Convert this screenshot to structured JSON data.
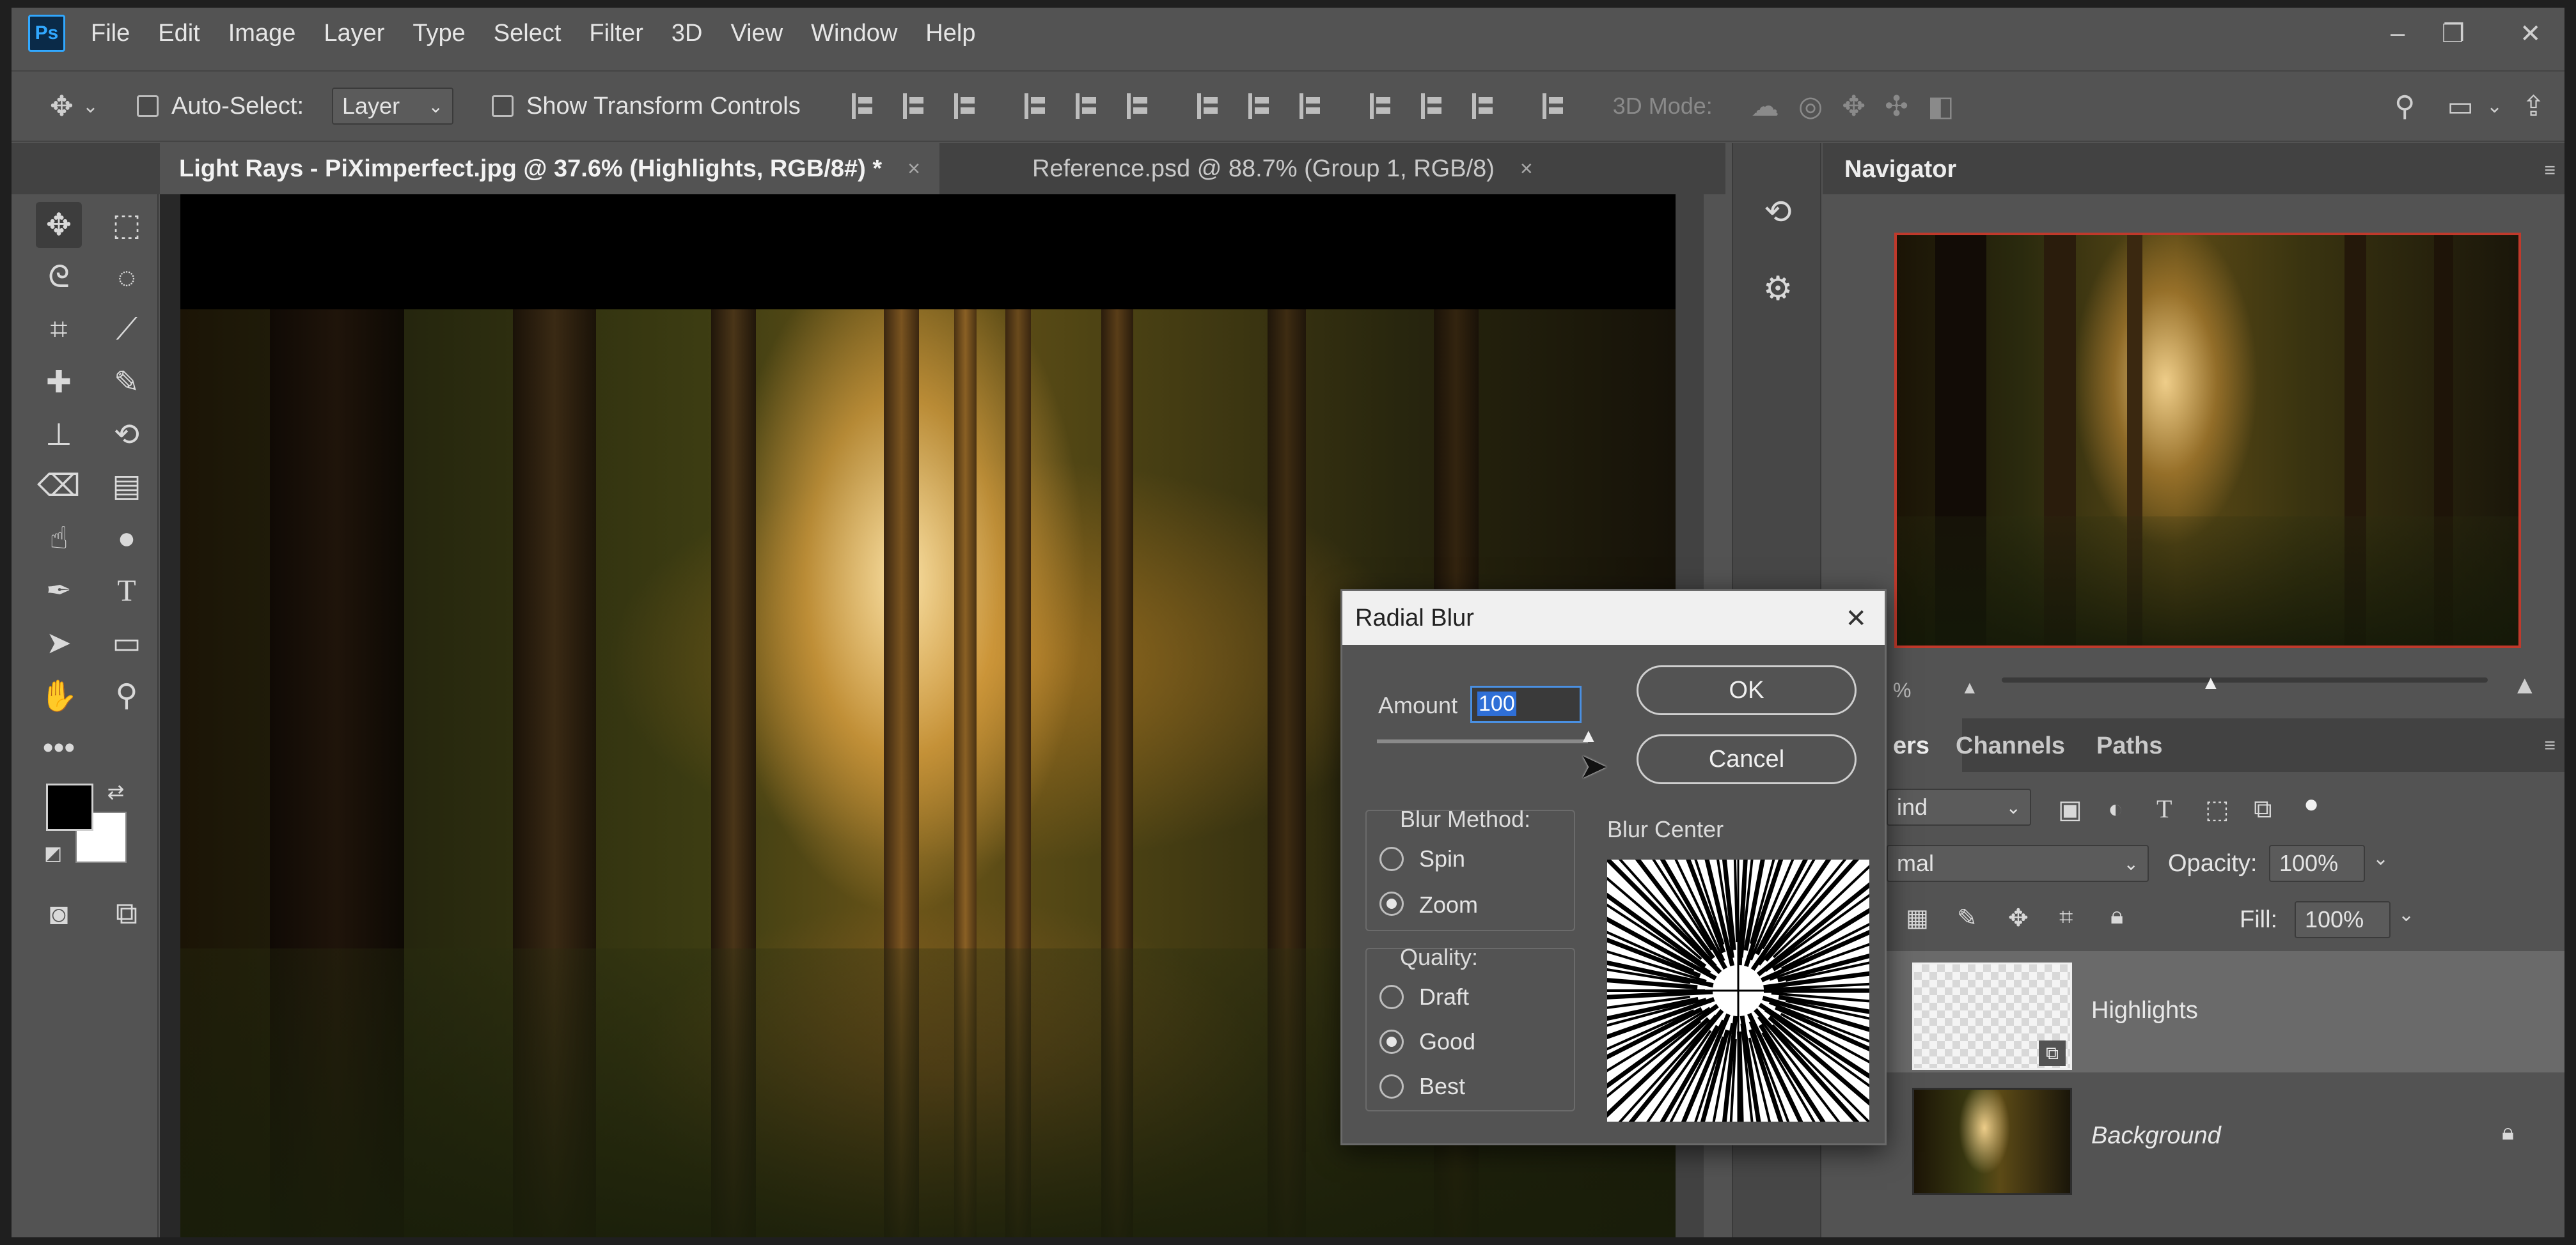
{
  "app": {
    "logo": "Ps"
  },
  "menu": [
    "File",
    "Edit",
    "Image",
    "Layer",
    "Type",
    "Select",
    "Filter",
    "3D",
    "View",
    "Window",
    "Help"
  ],
  "window_controls": {
    "minimize": "–",
    "restore": "❐",
    "close": "✕"
  },
  "options": {
    "auto_select_label": "Auto-Select:",
    "auto_select_value": "Layer",
    "show_transform_label": "Show Transform Controls",
    "threed_mode_label": "3D Mode:"
  },
  "tabs": [
    {
      "label": "Light Rays - PiXimperfect.jpg @ 37.6% (Highlights, RGB/8#) *",
      "active": true
    },
    {
      "label": "Reference.psd @ 88.7% (Group 1, RGB/8)",
      "active": false
    }
  ],
  "tab_close_glyph": "×",
  "navigator": {
    "title": "Navigator",
    "zoom_fragment": "%"
  },
  "layers_panel": {
    "tab_layers_fragment": "ers",
    "tab_channels": "Channels",
    "tab_paths": "Paths",
    "filter_kind_fragment": "ind",
    "blend_mode_fragment": "mal",
    "opacity_label": "Opacity:",
    "opacity_value": "100%",
    "fill_label": "Fill:",
    "fill_value": "100%",
    "layers": [
      {
        "name": "Highlights",
        "selected": true
      },
      {
        "name": "Background",
        "italic": true,
        "locked": true
      }
    ]
  },
  "dialog": {
    "title": "Radial Blur",
    "amount_label": "Amount",
    "amount_value": "100",
    "amount_fraction": 1.0,
    "ok_label": "OK",
    "cancel_label": "Cancel",
    "blur_method_label": "Blur Method:",
    "blur_methods": [
      {
        "label": "Spin",
        "selected": false
      },
      {
        "label": "Zoom",
        "selected": true
      }
    ],
    "quality_label": "Quality:",
    "qualities": [
      {
        "label": "Draft",
        "selected": false
      },
      {
        "label": "Good",
        "selected": true
      },
      {
        "label": "Best",
        "selected": false
      }
    ],
    "blur_center_label": "Blur Center"
  }
}
